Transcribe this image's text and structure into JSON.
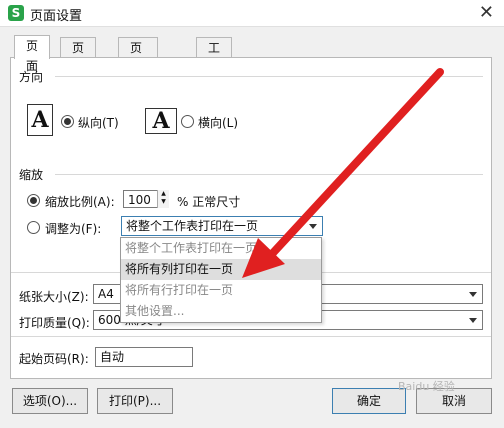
{
  "window": {
    "title": "页面设置",
    "app_icon": "S",
    "close_glyph": "✕"
  },
  "tabs": [
    {
      "label": "页面",
      "active": true
    },
    {
      "label": "页边距",
      "active": false
    },
    {
      "label": "页眉/页脚",
      "active": false
    },
    {
      "label": "工作表",
      "active": false
    }
  ],
  "orientation": {
    "section_label": "方向",
    "portrait_glyph": "A",
    "landscape_glyph": "A",
    "portrait_label": "纵向(T)",
    "landscape_label": "横向(L)",
    "selected": "portrait"
  },
  "scaling": {
    "section_label": "缩放",
    "scale_label": "缩放比例(A):",
    "scale_value": "100",
    "scale_suffix": "% 正常尺寸",
    "fit_label": "调整为(F):",
    "fit_selected": "将整个工作表打印在一页",
    "selected_mode": "scale",
    "dropdown_options": [
      "将整个工作表打印在一页",
      "将所有列打印在一页",
      "将所有行打印在一页",
      "其他设置..."
    ],
    "highlighted_option": "将所有列打印在一页"
  },
  "paper": {
    "size_label": "纸张大小(Z):",
    "size_value": "A4",
    "quality_label": "打印质量(Q):",
    "quality_value": "600 点/英寸"
  },
  "first_page": {
    "label": "起始页码(R):",
    "value": "自动"
  },
  "buttons": {
    "options": "选项(O)...",
    "print": "打印(P)...",
    "ok": "确定",
    "cancel": "取消"
  },
  "watermark": "Baidu 经验",
  "colors": {
    "annotation_arrow": "#e02020",
    "focus_border": "#3c7fb1",
    "app_icon": "#2aa34a"
  }
}
